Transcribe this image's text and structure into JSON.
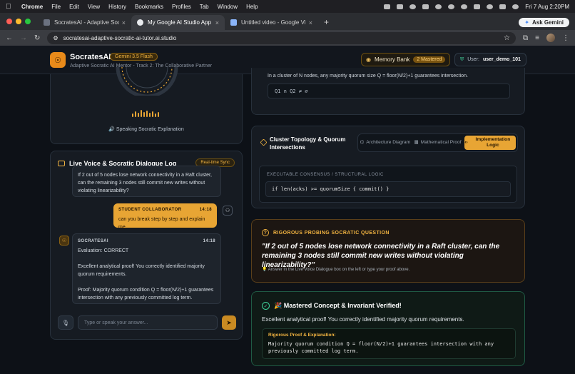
{
  "menubar": {
    "app": "Chrome",
    "items": [
      "File",
      "Edit",
      "View",
      "History",
      "Bookmarks",
      "Profiles",
      "Tab",
      "Window",
      "Help"
    ],
    "clock": "Fri 7 Aug  2:20PM"
  },
  "browser": {
    "tabs": [
      {
        "title": "SocratesAI - Adaptive Socrat",
        "active": false
      },
      {
        "title": "My Google AI Studio App",
        "active": true
      },
      {
        "title": "Untitled video - Google Vids",
        "active": false
      }
    ],
    "ask_gemini": "Ask Gemini",
    "url": "socratesai-adaptive-socratic-ai-tutor.ai.studio"
  },
  "header": {
    "brand": "SocratesAI",
    "model_badge": "Gemini 3.5 Flash",
    "subtitle": "Adaptive Socratic AI Mentor - Track 2: The Collaborative Partner",
    "memory_label": "Memory Bank",
    "memory_count": "2 Mastered",
    "user_prefix": "User:",
    "user_name": "user_demo_101"
  },
  "voice": {
    "status": "Speaking Socratic Explanation",
    "levels": [
      0.5,
      0.8,
      0.6,
      1.0,
      0.7,
      0.9,
      0.6,
      0.8,
      0.5,
      0.7
    ]
  },
  "dialog": {
    "title": "Live Voice & Socratic Dialogue Log",
    "sync_badge": "Real-time Sync",
    "ai_message_1": "If 2 out of 5 nodes lose network connectivity in a Raft cluster, can the remaining 3 nodes still commit new writes without violating linearizability?",
    "user_label": "STUDENT COLLABORATOR",
    "user_time": "14:18",
    "user_message": "can you break step by step and explain me",
    "ai_label": "SOCRATESAI",
    "ai_time": "14:18",
    "ai_eval": "Evaluation: CORRECT",
    "ai_para1": "Excellent analytical proof! You correctly identified majority quorum requirements.",
    "ai_para2": "Proof: Majority quorum condition Q = floor(N/2)+1 guarantees intersection with any previously committed log term.",
    "input_placeholder": "Type or speak your answer..."
  },
  "quorum": {
    "statement": "In a cluster of N nodes, any majority quorum size Q = floor(N/2)+1 guarantees intersection.",
    "formula": "Q1 ∩ Q2 ≠ ∅"
  },
  "topology": {
    "title": "Cluster Topology & Quorum Intersections",
    "tabs": [
      {
        "label": "Architecture Diagram",
        "active": false
      },
      {
        "label": "Mathematical Proof",
        "active": false
      },
      {
        "label": "Implementation Logic",
        "active": true
      }
    ],
    "code_label": "EXECUTABLE CONSENSUS / STRUCTURAL LOGIC",
    "code": "if len(acks) >= quorumSize { commit() }"
  },
  "probe": {
    "label": "RIGOROUS PROBING SOCRATIC QUESTION",
    "question": "\"If 2 out of 5 nodes lose network connectivity in a Raft cluster, can the remaining 3 nodes still commit new writes without violating linearizability?\"",
    "hint": "💡 Answer in the Live Voice Dialogue box on the left or type your proof above."
  },
  "mastered": {
    "title": "🎉 Mastered Concept & Invariant Verified!",
    "message": "Excellent analytical proof! You correctly identified majority quorum requirements.",
    "proof_label": "Rigorous Proof & Explanation:",
    "proof_text": "Majority quorum condition Q = floor(N/2)+1 guarantees intersection with any previously committed log term."
  },
  "colors": {
    "accent": "#e8a534",
    "background": "#0d1117",
    "panel": "#161b22",
    "success": "#3fd19a"
  }
}
